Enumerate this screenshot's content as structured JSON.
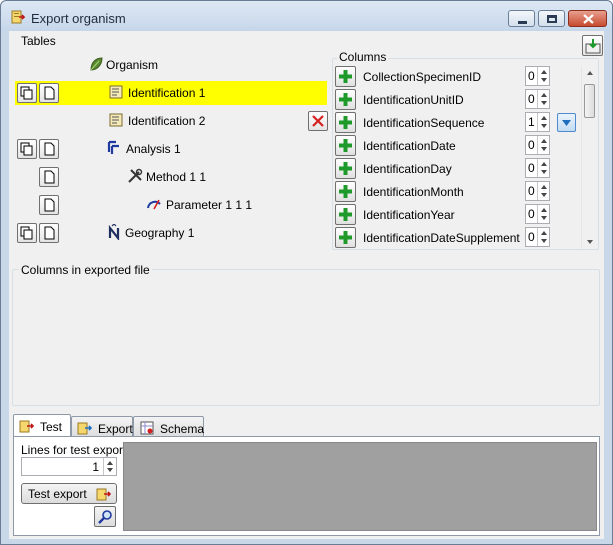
{
  "window": {
    "title": "Export organism"
  },
  "tables": {
    "group_label": "Tables",
    "nodes": [
      {
        "label": "Organism",
        "selected": false
      },
      {
        "label": "Identification 1",
        "selected": true
      },
      {
        "label": "Identification 2",
        "selected": false
      },
      {
        "label": "Analysis 1",
        "selected": false
      },
      {
        "label": "Method 1 1",
        "selected": false
      },
      {
        "label": "Parameter 1 1 1",
        "selected": false
      },
      {
        "label": "Geography 1",
        "selected": false
      }
    ]
  },
  "columns": {
    "group_label": "Columns",
    "items": [
      {
        "name": "CollectionSpecimenID",
        "order": "0"
      },
      {
        "name": "IdentificationUnitID",
        "order": "0"
      },
      {
        "name": "IdentificationSequence",
        "order": "1"
      },
      {
        "name": "IdentificationDate",
        "order": "0"
      },
      {
        "name": "IdentificationDay",
        "order": "0"
      },
      {
        "name": "IdentificationMonth",
        "order": "0"
      },
      {
        "name": "IdentificationYear",
        "order": "0"
      },
      {
        "name": "IdentificationDateSupplement",
        "order": "0"
      }
    ]
  },
  "exported": {
    "group_label": "Columns in exported file"
  },
  "tabs": [
    {
      "label": "Test",
      "active": true
    },
    {
      "label": "Export",
      "active": false
    },
    {
      "label": "Schema",
      "active": false
    }
  ],
  "test": {
    "lines_label": "Lines for test export:",
    "lines_value": "1",
    "test_export_label": "Test export"
  },
  "colors": {
    "selection": "#ffff00",
    "plus": "#1e9a2a",
    "delete": "#d62020"
  }
}
